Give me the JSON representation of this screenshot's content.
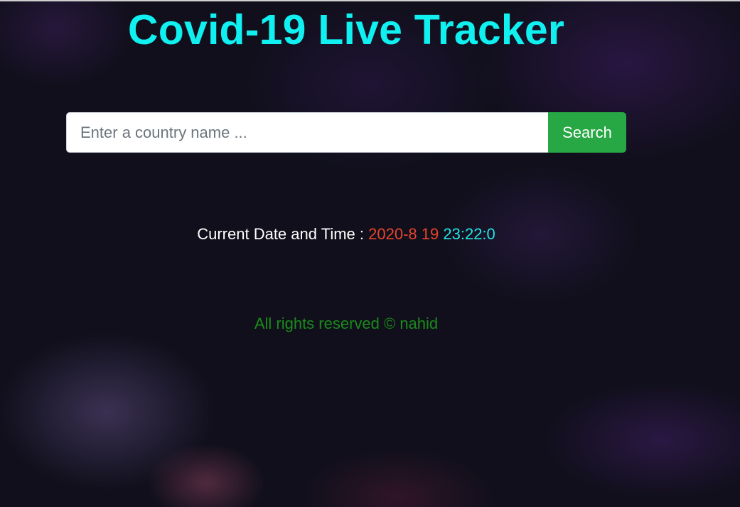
{
  "header": {
    "title": "Covid-19 Live Tracker"
  },
  "search": {
    "placeholder": "Enter a country name ...",
    "value": "",
    "button_label": "Search"
  },
  "datetime": {
    "label": "Current Date and Time :",
    "date": "2020-8",
    "day": "19",
    "time": "23:22:0"
  },
  "footer": {
    "text": "All rights reserved © nahid"
  },
  "colors": {
    "title": "#11f0f0",
    "search_button": "#28a745",
    "date": "#e8452c",
    "time": "#22e5e5",
    "footer": "#1a8c1a"
  }
}
